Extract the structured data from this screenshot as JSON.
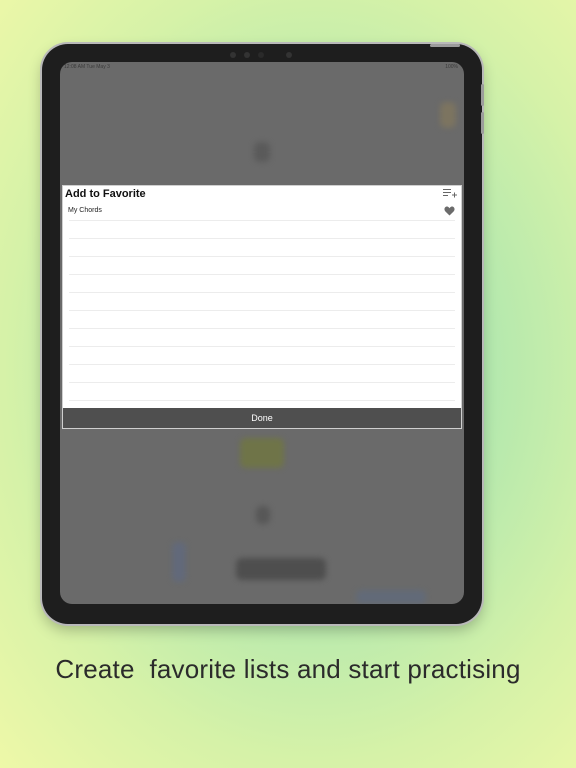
{
  "status_bar": {
    "time": "12:08 AM  Tue May 3",
    "battery": "100%"
  },
  "dialog": {
    "title": "Add to Favorite",
    "add_list_icon": "playlist-add-icon",
    "lists": [
      {
        "label": "My Chords",
        "icon": "heart-icon"
      }
    ],
    "done_label": "Done"
  },
  "caption": "Create  favorite lists and start practising",
  "colors": {
    "done_button": "#4f4f4f",
    "dim_overlay": "#6a6a6a",
    "heart": "#6b6b6b"
  }
}
